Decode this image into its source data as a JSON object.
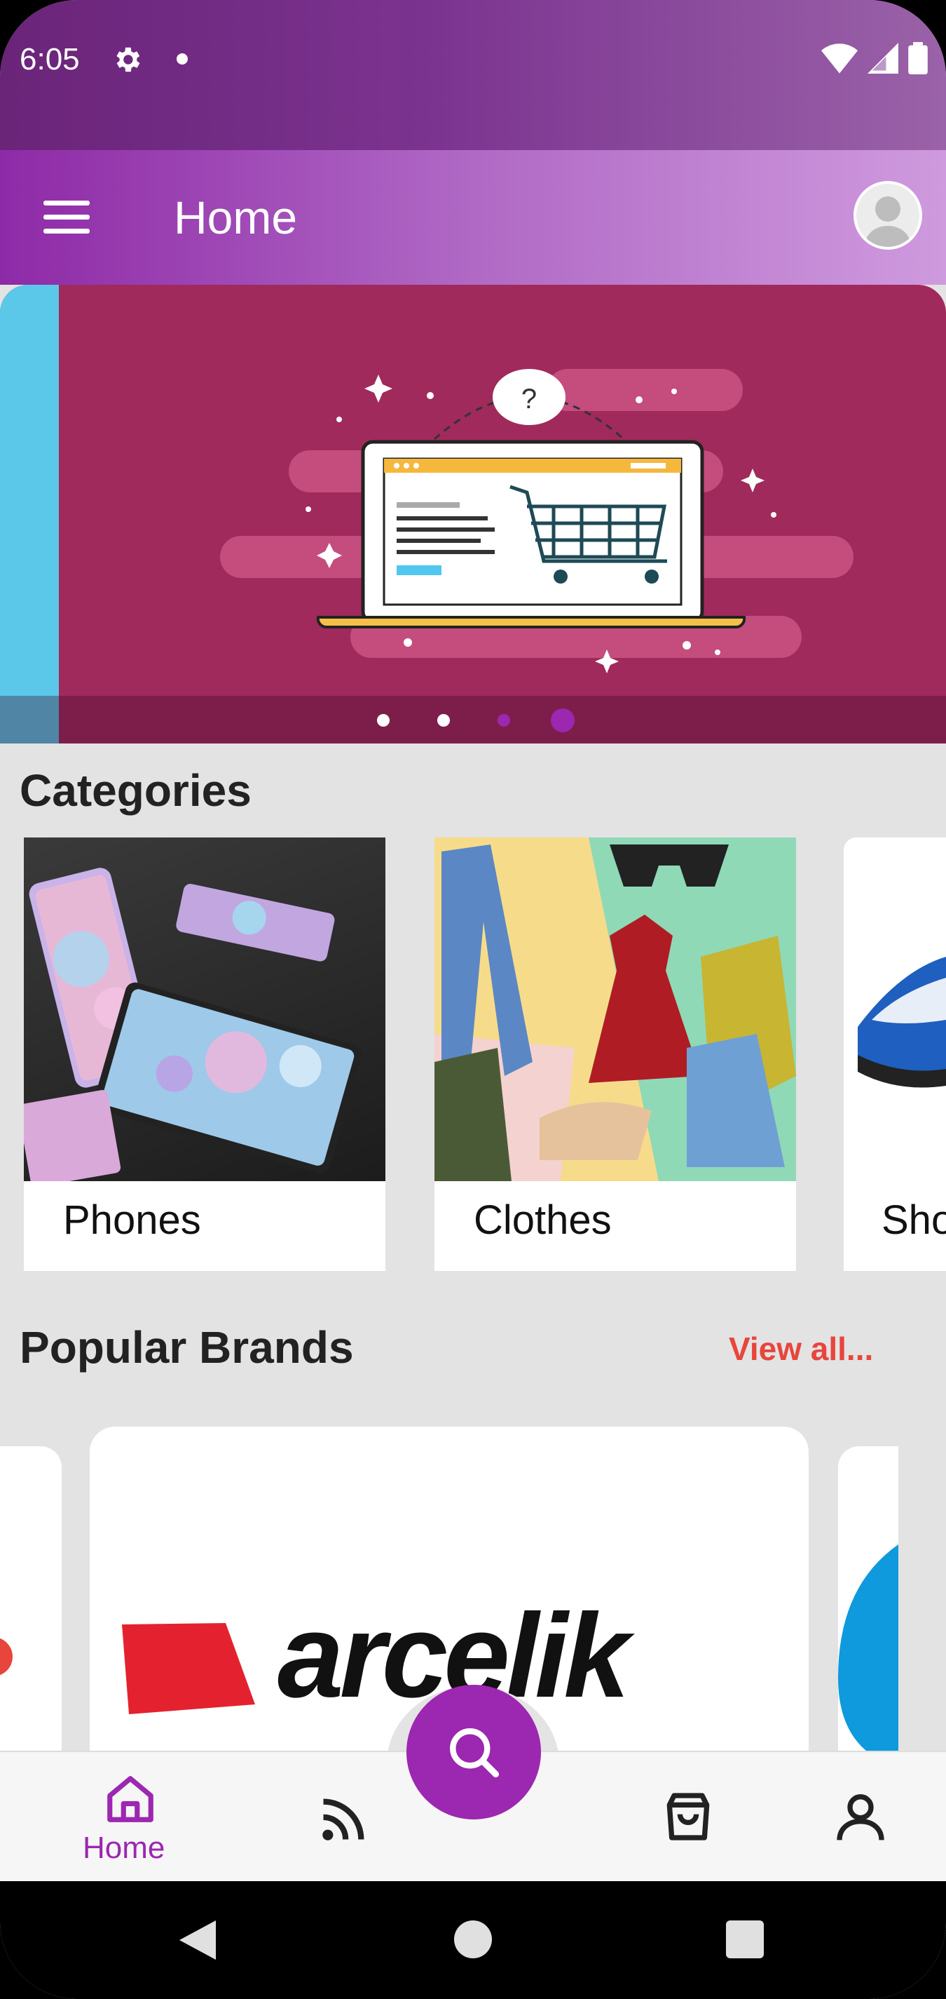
{
  "status_bar": {
    "time": "6:05",
    "icons": [
      "gear-icon",
      "notification-dot",
      "wifi-icon",
      "signal-icon",
      "battery-icon"
    ]
  },
  "app_bar": {
    "title": "Home",
    "menu_icon": "hamburger-menu-icon",
    "avatar_icon": "user-avatar"
  },
  "banner": {
    "illustration": "online shopping laptop with cart",
    "badge": "?",
    "dots_count": 4,
    "active_dot": 3
  },
  "categories": {
    "title": "Categories",
    "items": [
      {
        "label": "Phones"
      },
      {
        "label": "Clothes"
      },
      {
        "label": "Sho"
      }
    ]
  },
  "brands": {
    "title": "Popular Brands",
    "view_all": "View all...",
    "featured": "arcelik"
  },
  "bottom_nav": {
    "items": [
      {
        "icon": "home-icon",
        "label": "Home"
      },
      {
        "icon": "feed-icon"
      },
      {
        "icon": "search-icon"
      },
      {
        "icon": "shopping-bag-icon"
      },
      {
        "icon": "profile-icon"
      }
    ]
  },
  "colors": {
    "primary": "#9c27b0",
    "accent": "#e8453c",
    "banner": "#a02a5c"
  }
}
